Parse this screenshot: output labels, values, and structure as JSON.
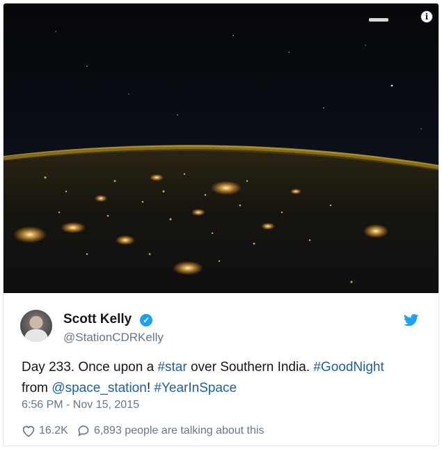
{
  "tweet": {
    "author_name": "Scott Kelly",
    "handle": "@StationCDRKelly",
    "text_parts": [
      {
        "text": "Day 233. Once upon a ",
        "link": false
      },
      {
        "text": "#star",
        "link": true
      },
      {
        "text": " over Southern India. ",
        "link": false
      },
      {
        "text": "#GoodNight",
        "link": true
      },
      {
        "text": " from ",
        "link": false
      },
      {
        "text": "@space_station",
        "link": true
      },
      {
        "text": "! ",
        "link": false
      },
      {
        "text": "#YearInSpace",
        "link": true
      }
    ],
    "timestamp": "6:56 PM - Nov 15, 2015",
    "likes": "16.2K",
    "conversation": "6,893 people are talking about this"
  },
  "icons": {
    "info": "info-icon",
    "verified": "verified-badge-icon",
    "twitter": "twitter-bird-icon",
    "heart": "heart-icon",
    "comment": "comment-icon"
  },
  "colors": {
    "link": "#1b5f9e",
    "twitter_blue": "#1da1f2",
    "secondary_text": "#657786"
  }
}
